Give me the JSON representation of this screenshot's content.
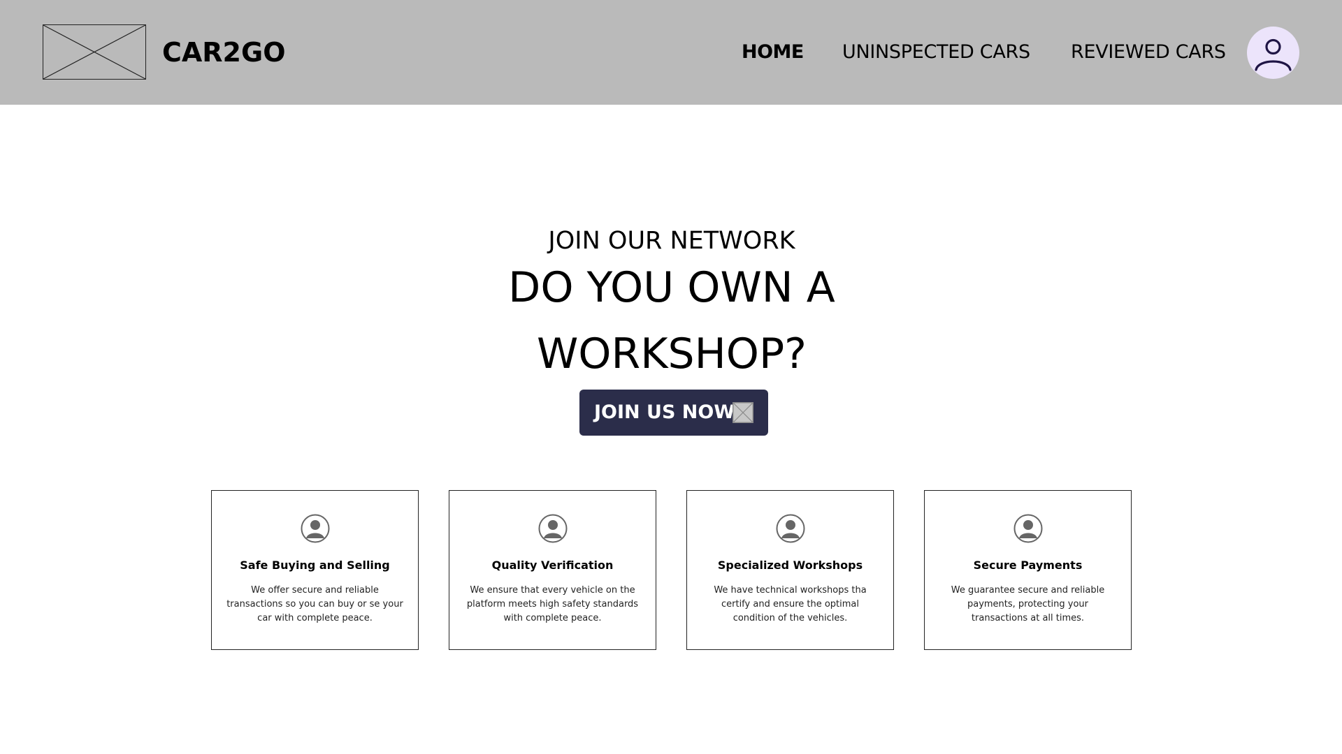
{
  "header": {
    "brand": "CAR2GO",
    "nav": {
      "home": "HOME",
      "uninspected": "UNINSPECTED CARS",
      "reviewed": "REVIEWED CARS"
    },
    "avatar_icon": "user-icon",
    "background_color": "#bababa",
    "avatar_bg_color": "#ece4fb",
    "avatar_icon_color": "#1f1545"
  },
  "hero": {
    "kicker": "JOIN OUR NETWORK",
    "title_line1": "DO YOU OWN A",
    "title_line2": "WORKSHOP?",
    "cta_label": "JOIN US NOW",
    "cta_icon": "image-placeholder-icon",
    "cta_bg_color": "#2b2d4a"
  },
  "features": [
    {
      "icon": "user-silhouette-icon",
      "title": "Safe Buying and Selling",
      "description": "We offer secure and reliable transactions so you can buy or se your car with complete peace."
    },
    {
      "icon": "user-silhouette-icon",
      "title": "Quality Verification",
      "description": "We ensure that every vehicle on the platform meets high safety standards with complete peace."
    },
    {
      "icon": "user-silhouette-icon",
      "title": "Specialized Workshops",
      "description": "We have technical workshops tha certify and ensure the optimal condition of the vehicles."
    },
    {
      "icon": "user-silhouette-icon",
      "title": "Secure Payments",
      "description": "We guarantee secure and reliable payments, protecting your transactions at all times."
    }
  ]
}
